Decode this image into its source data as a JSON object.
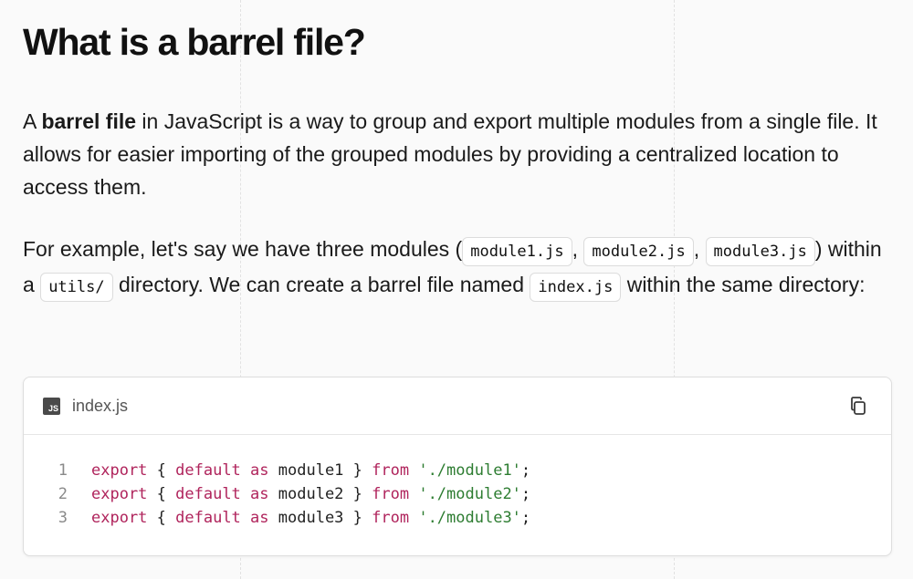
{
  "article": {
    "heading": "What is a barrel file?",
    "p1": {
      "prefix": "A ",
      "bold": "barrel file",
      "rest": " in JavaScript is a way to group and export multiple modules from a single file. It allows for easier importing of the grouped modules by providing a centralized location to access them."
    },
    "p2": {
      "t1": "For example, let's say we have three modules (",
      "c1": "module1.js",
      "t2": ",",
      "c2": "module2.js",
      "t3": ",",
      "c3": "module3.js",
      "t4": ") within a",
      "c4": "utils/",
      "t5": "directory. We can create a barrel file named",
      "c5": "index.js",
      "t6": "within the same directory:"
    }
  },
  "code_block": {
    "file_icon_label": "JS",
    "file_icon": "javascript-file-icon",
    "filename": "index.js",
    "copy_icon": "copy-icon",
    "lines": [
      {
        "num": "1",
        "tokens": [
          {
            "text": "export",
            "type": "kw"
          },
          {
            "text": " { ",
            "type": "plain"
          },
          {
            "text": "default",
            "type": "kw"
          },
          {
            "text": " ",
            "type": "plain"
          },
          {
            "text": "as",
            "type": "kw"
          },
          {
            "text": " module1 } ",
            "type": "plain"
          },
          {
            "text": "from",
            "type": "kw"
          },
          {
            "text": " ",
            "type": "plain"
          },
          {
            "text": "'./module1'",
            "type": "str"
          },
          {
            "text": ";",
            "type": "plain"
          }
        ]
      },
      {
        "num": "2",
        "tokens": [
          {
            "text": "export",
            "type": "kw"
          },
          {
            "text": " { ",
            "type": "plain"
          },
          {
            "text": "default",
            "type": "kw"
          },
          {
            "text": " ",
            "type": "plain"
          },
          {
            "text": "as",
            "type": "kw"
          },
          {
            "text": " module2 } ",
            "type": "plain"
          },
          {
            "text": "from",
            "type": "kw"
          },
          {
            "text": " ",
            "type": "plain"
          },
          {
            "text": "'./module2'",
            "type": "str"
          },
          {
            "text": ";",
            "type": "plain"
          }
        ]
      },
      {
        "num": "3",
        "tokens": [
          {
            "text": "export",
            "type": "kw"
          },
          {
            "text": " { ",
            "type": "plain"
          },
          {
            "text": "default",
            "type": "kw"
          },
          {
            "text": " ",
            "type": "plain"
          },
          {
            "text": "as",
            "type": "kw"
          },
          {
            "text": " module3 } ",
            "type": "plain"
          },
          {
            "text": "from",
            "type": "kw"
          },
          {
            "text": " ",
            "type": "plain"
          },
          {
            "text": "'./module3'",
            "type": "str"
          },
          {
            "text": ";",
            "type": "plain"
          }
        ]
      }
    ]
  },
  "colors": {
    "keyword": "#b0245c",
    "string": "#2e7d32",
    "line_number": "#8a8a8a",
    "background": "#fafafa"
  }
}
